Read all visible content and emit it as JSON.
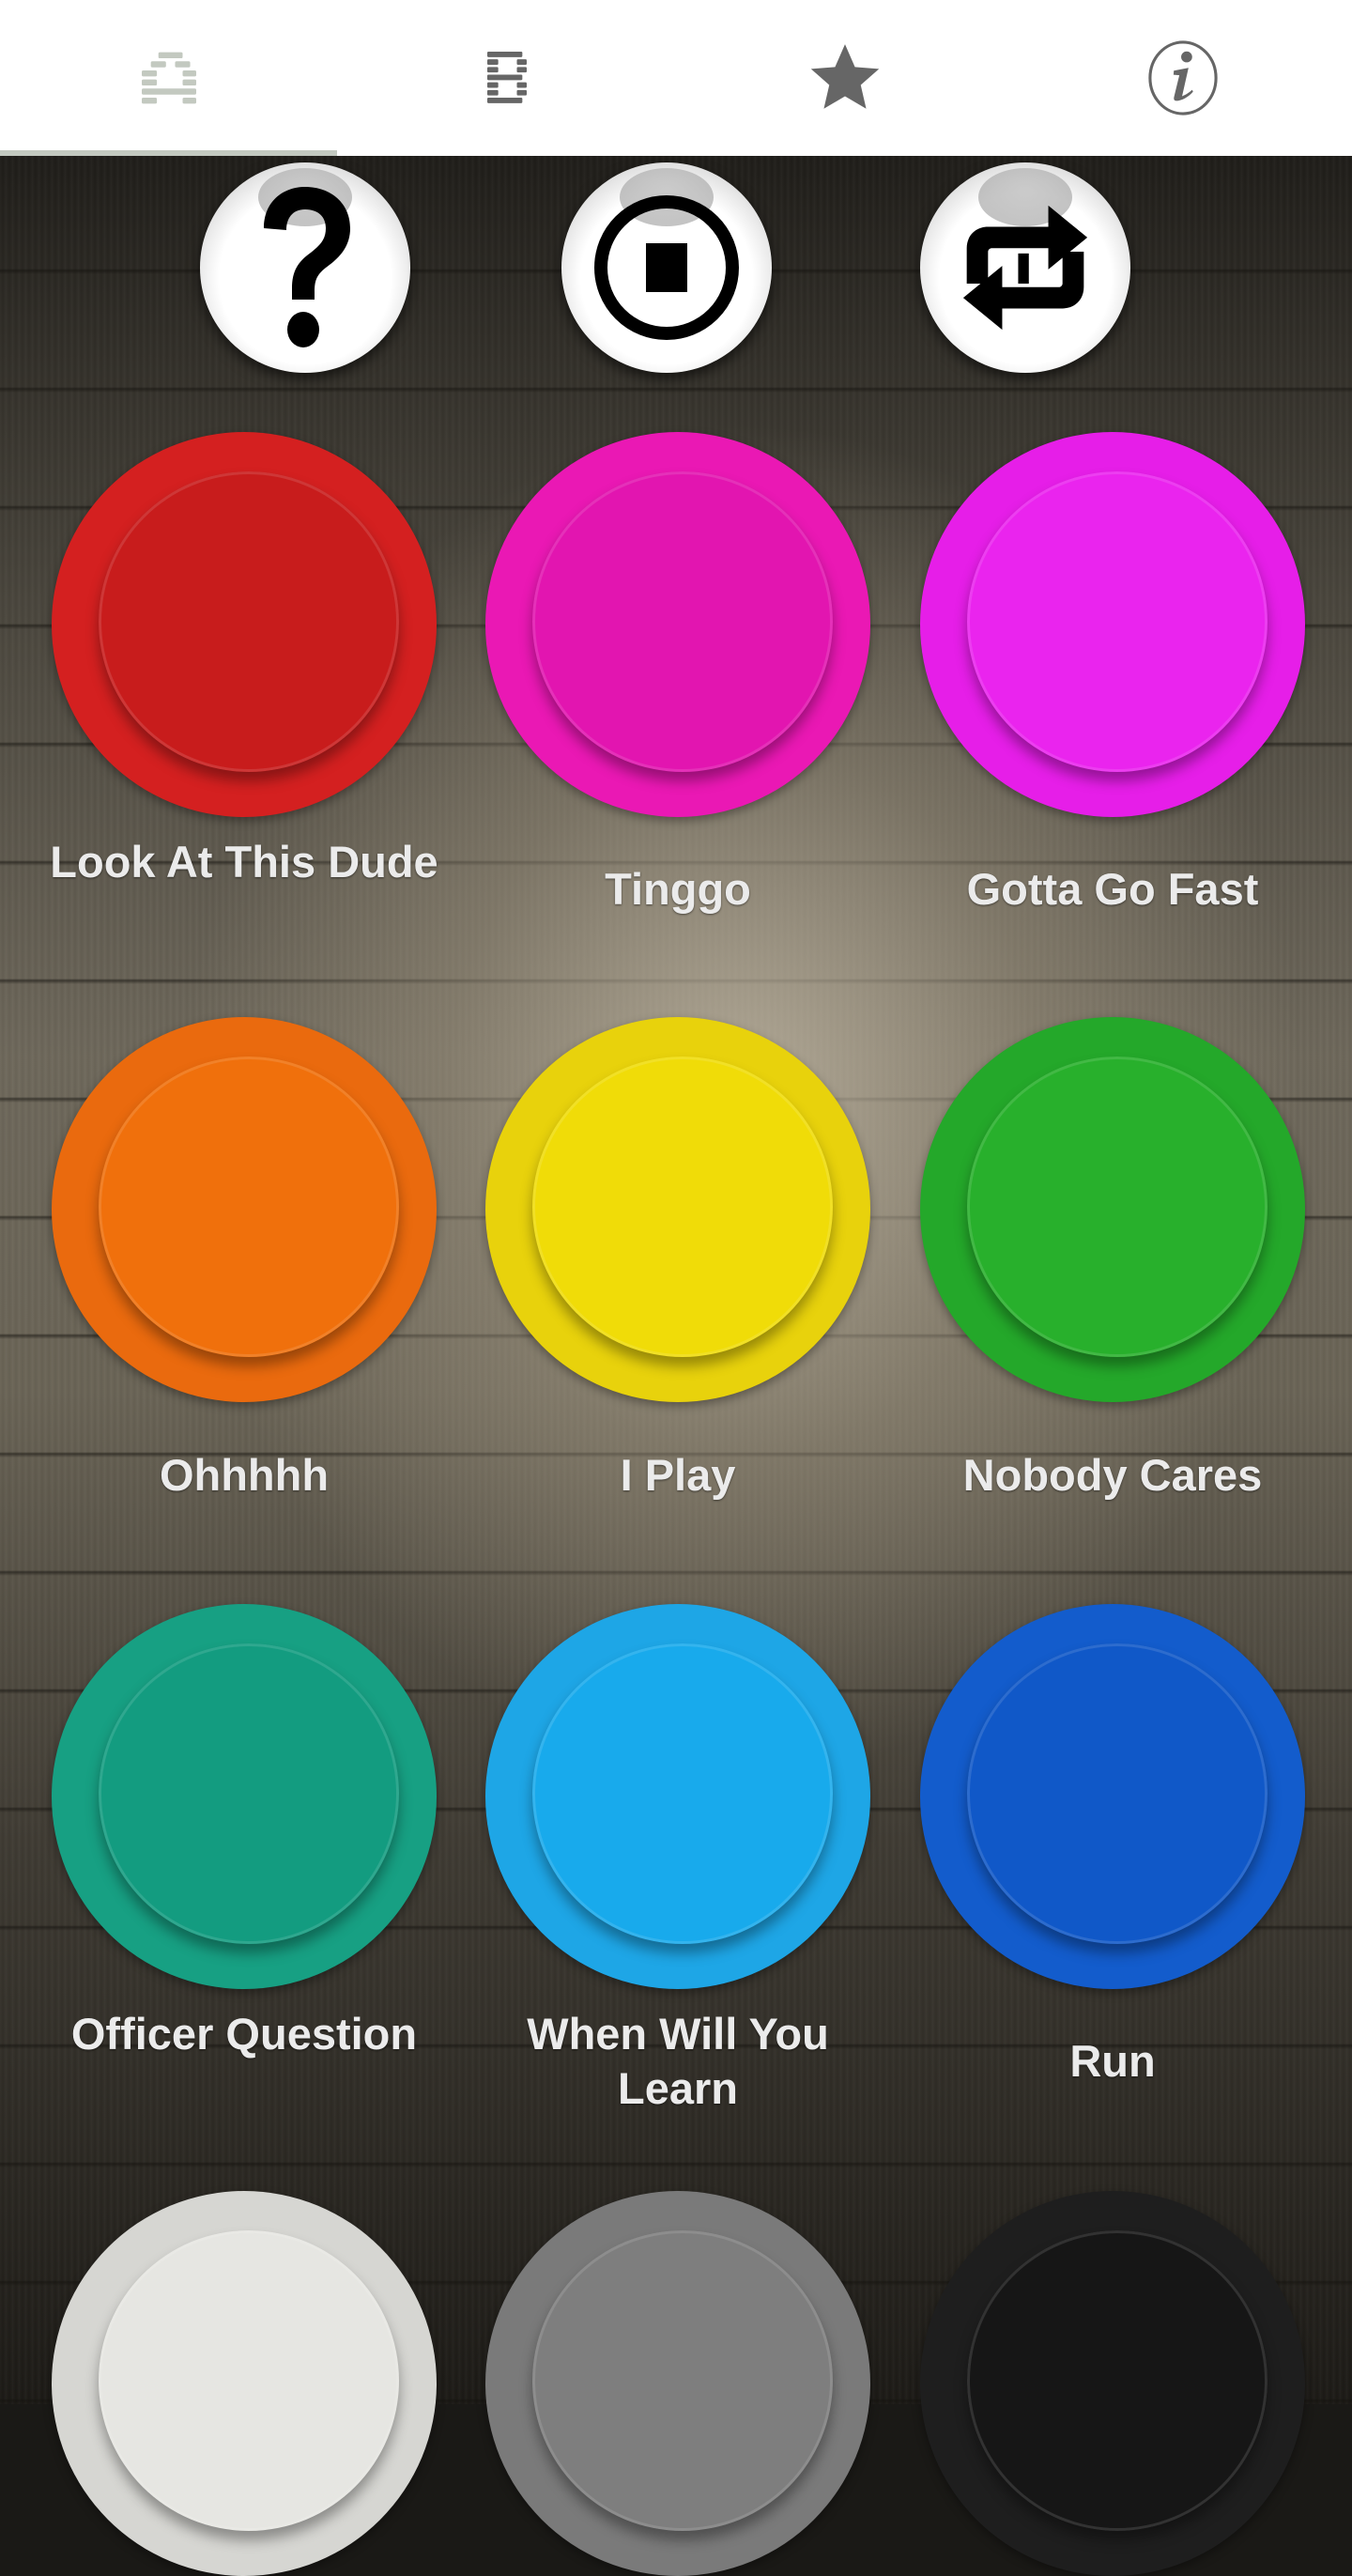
{
  "tabs": [
    {
      "name": "tab-a",
      "label": "A",
      "icon": "letter-a-icon",
      "active": true
    },
    {
      "name": "tab-b",
      "label": "B",
      "icon": "letter-b-icon",
      "active": false
    },
    {
      "name": "tab-favorites",
      "label": "Favorites",
      "icon": "star-icon",
      "active": false
    },
    {
      "name": "tab-info",
      "label": "Info",
      "icon": "info-icon",
      "active": false
    }
  ],
  "controls": [
    {
      "name": "help-button",
      "icon": "question-mark-icon"
    },
    {
      "name": "stop-button",
      "icon": "stop-icon"
    },
    {
      "name": "repeat-button",
      "icon": "repeat-one-icon"
    }
  ],
  "colors": {
    "tab_active": "#c3c9c0",
    "tab_inactive": "#666666",
    "label_text": "#ebebeb"
  },
  "sound_buttons": [
    {
      "label": "Look At This Dude",
      "color": "#d42020",
      "cap": "#c81c1c"
    },
    {
      "label": "Tinggo",
      "color": "#ea18b4",
      "cap": "#e215b0"
    },
    {
      "label": "Gotta Go Fast",
      "color": "#e61ee8",
      "cap": "#ea24ee"
    },
    {
      "label": "Ohhhhh",
      "color": "#ea6a0e",
      "cap": "#f0700c"
    },
    {
      "label": "I Play",
      "color": "#e8d20c",
      "cap": "#f0dc08"
    },
    {
      "label": "Nobody Cares",
      "color": "#24a82a",
      "cap": "#28b02c"
    },
    {
      "label": "Officer Question",
      "color": "#17a083",
      "cap": "#139c80"
    },
    {
      "label": "When Will You Learn",
      "color": "#1ea6e6",
      "cap": "#18aaec"
    },
    {
      "label": "Run",
      "color": "#135ccc",
      "cap": "#1058c8"
    },
    {
      "label": "",
      "color": "#d6d6d2",
      "cap": "#e6e6e2"
    },
    {
      "label": "",
      "color": "#7a7a7a",
      "cap": "#7e7e7e"
    },
    {
      "label": "",
      "color": "#1e1e1e",
      "cap": "#161616"
    }
  ]
}
